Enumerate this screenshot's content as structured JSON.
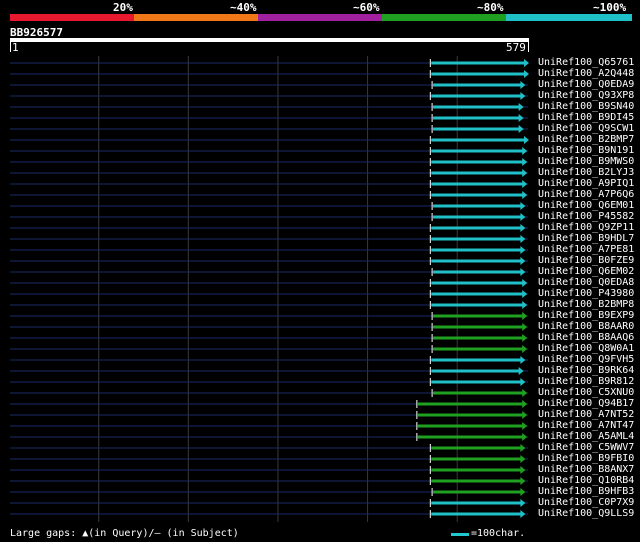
{
  "scale_labels": [
    "20%",
    "~40%",
    "~60%",
    "~80%",
    "~100%"
  ],
  "scale_colors": [
    "#e8182f",
    "#f07818",
    "#a020a0",
    "#20a020",
    "#20c0c8"
  ],
  "query": {
    "name": "BB926577",
    "start": "1",
    "end": "579",
    "length": 579
  },
  "chart_data": {
    "type": "alignment-overview",
    "x_range": [
      1,
      579
    ],
    "hits": [
      {
        "id": "UniRef100_Q65761",
        "start": 470,
        "end": 579,
        "identity": "~100%"
      },
      {
        "id": "UniRef100_A2Q448",
        "start": 470,
        "end": 579,
        "identity": "~100%"
      },
      {
        "id": "UniRef100_Q0EDA9",
        "start": 472,
        "end": 575,
        "identity": "~100%"
      },
      {
        "id": "UniRef100_Q93XP8",
        "start": 470,
        "end": 575,
        "identity": "~100%"
      },
      {
        "id": "UniRef100_B9SN40",
        "start": 472,
        "end": 573,
        "identity": "~100%"
      },
      {
        "id": "UniRef100_B9DI45",
        "start": 472,
        "end": 573,
        "identity": "~100%"
      },
      {
        "id": "UniRef100_Q9SCW1",
        "start": 472,
        "end": 573,
        "identity": "~100%"
      },
      {
        "id": "UniRef100_B2BMP7",
        "start": 470,
        "end": 579,
        "identity": "~100%"
      },
      {
        "id": "UniRef100_B9N191",
        "start": 470,
        "end": 577,
        "identity": "~100%"
      },
      {
        "id": "UniRef100_B9MWS0",
        "start": 470,
        "end": 577,
        "identity": "~100%"
      },
      {
        "id": "UniRef100_B2LYJ3",
        "start": 470,
        "end": 577,
        "identity": "~100%"
      },
      {
        "id": "UniRef100_A9PIQ1",
        "start": 470,
        "end": 577,
        "identity": "~100%"
      },
      {
        "id": "UniRef100_A7P6Q6",
        "start": 470,
        "end": 577,
        "identity": "~100%"
      },
      {
        "id": "UniRef100_Q6EM01",
        "start": 472,
        "end": 575,
        "identity": "~100%"
      },
      {
        "id": "UniRef100_P45582",
        "start": 472,
        "end": 575,
        "identity": "~100%"
      },
      {
        "id": "UniRef100_Q9ZP11",
        "start": 470,
        "end": 575,
        "identity": "~100%"
      },
      {
        "id": "UniRef100_B9HDL7",
        "start": 470,
        "end": 575,
        "identity": "~100%"
      },
      {
        "id": "UniRef100_A7PE81",
        "start": 470,
        "end": 575,
        "identity": "~100%"
      },
      {
        "id": "UniRef100_B0FZE9",
        "start": 470,
        "end": 575,
        "identity": "~100%"
      },
      {
        "id": "UniRef100_Q6EM02",
        "start": 472,
        "end": 575,
        "identity": "~100%"
      },
      {
        "id": "UniRef100_Q0EDA8",
        "start": 470,
        "end": 577,
        "identity": "~100%"
      },
      {
        "id": "UniRef100_P43980",
        "start": 470,
        "end": 577,
        "identity": "~100%"
      },
      {
        "id": "UniRef100_B2BMP8",
        "start": 470,
        "end": 577,
        "identity": "~100%"
      },
      {
        "id": "UniRef100_B9EXP9",
        "start": 472,
        "end": 577,
        "identity": "~80%"
      },
      {
        "id": "UniRef100_B8AAR0",
        "start": 472,
        "end": 577,
        "identity": "~80%"
      },
      {
        "id": "UniRef100_B8AAQ6",
        "start": 472,
        "end": 577,
        "identity": "~80%"
      },
      {
        "id": "UniRef100_Q8W0A1",
        "start": 472,
        "end": 577,
        "identity": "~80%"
      },
      {
        "id": "UniRef100_Q9FVH5",
        "start": 470,
        "end": 575,
        "identity": "~100%"
      },
      {
        "id": "UniRef100_B9RK64",
        "start": 470,
        "end": 573,
        "identity": "~100%"
      },
      {
        "id": "UniRef100_B9R812",
        "start": 470,
        "end": 575,
        "identity": "~100%"
      },
      {
        "id": "UniRef100_C5XNU0",
        "start": 472,
        "end": 577,
        "identity": "~80%"
      },
      {
        "id": "UniRef100_Q94B17",
        "start": 455,
        "end": 577,
        "identity": "~80%"
      },
      {
        "id": "UniRef100_A7NT52",
        "start": 455,
        "end": 577,
        "identity": "~80%"
      },
      {
        "id": "UniRef100_A7NT47",
        "start": 455,
        "end": 577,
        "identity": "~80%"
      },
      {
        "id": "UniRef100_A5AML4",
        "start": 455,
        "end": 577,
        "identity": "~80%"
      },
      {
        "id": "UniRef100_C5WWV7",
        "start": 470,
        "end": 575,
        "identity": "~80%"
      },
      {
        "id": "UniRef100_B9FBI0",
        "start": 470,
        "end": 575,
        "identity": "~80%"
      },
      {
        "id": "UniRef100_B8ANX7",
        "start": 470,
        "end": 575,
        "identity": "~80%"
      },
      {
        "id": "UniRef100_Q10RB4",
        "start": 470,
        "end": 575,
        "identity": "~80%"
      },
      {
        "id": "UniRef100_B9HFB3",
        "start": 472,
        "end": 575,
        "identity": "~80%"
      },
      {
        "id": "UniRef100_C0P7X9",
        "start": 470,
        "end": 575,
        "identity": "~100%"
      },
      {
        "id": "UniRef100_Q9LLS9",
        "start": 470,
        "end": 575,
        "identity": "~100%"
      }
    ]
  },
  "legend": {
    "gaps_text": "Large gaps: ▲(in Query)/— (in Subject)",
    "scale_text": "=100char."
  }
}
